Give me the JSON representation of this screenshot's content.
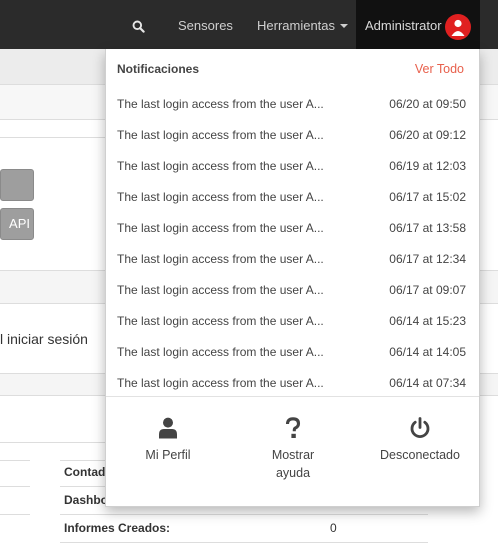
{
  "navbar": {
    "search_icon": "search-icon",
    "sensores": "Sensores",
    "herramientas": "Herramientas",
    "user": "Administrator"
  },
  "background": {
    "button_api": "API",
    "login_text": "l iniciar sesión",
    "rows": [
      {
        "label": "Contad",
        "value": ""
      },
      {
        "label": "Dashbo",
        "value": ""
      },
      {
        "label": "Informes Creados:",
        "value": "0"
      }
    ]
  },
  "notifications": {
    "title": "Notificaciones",
    "view_all": "Ver Todo",
    "items": [
      {
        "text": "The last login access from the user A...",
        "time": "06/20 at 09:50"
      },
      {
        "text": "The last login access from the user A...",
        "time": "06/20 at 09:12"
      },
      {
        "text": "The last login access from the user A...",
        "time": "06/19 at 12:03"
      },
      {
        "text": "The last login access from the user A...",
        "time": "06/17 at 15:02"
      },
      {
        "text": "The last login access from the user A...",
        "time": "06/17 at 13:58"
      },
      {
        "text": "The last login access from the user A...",
        "time": "06/17 at 12:34"
      },
      {
        "text": "The last login access from the user A...",
        "time": "06/17 at 09:07"
      },
      {
        "text": "The last login access from the user A...",
        "time": "06/14 at 15:23"
      },
      {
        "text": "The last login access from the user A...",
        "time": "06/14 at 14:05"
      },
      {
        "text": "The last login access from the user A...",
        "time": "06/14 at 07:34"
      }
    ],
    "actions": {
      "profile": "Mi Perfil",
      "help_line1": "Mostrar",
      "help_line2": "ayuda",
      "logout": "Desconectado"
    }
  },
  "colors": {
    "navbar": "#2b2b2b",
    "accent_link": "#e8604c",
    "avatar": "#e02020"
  }
}
